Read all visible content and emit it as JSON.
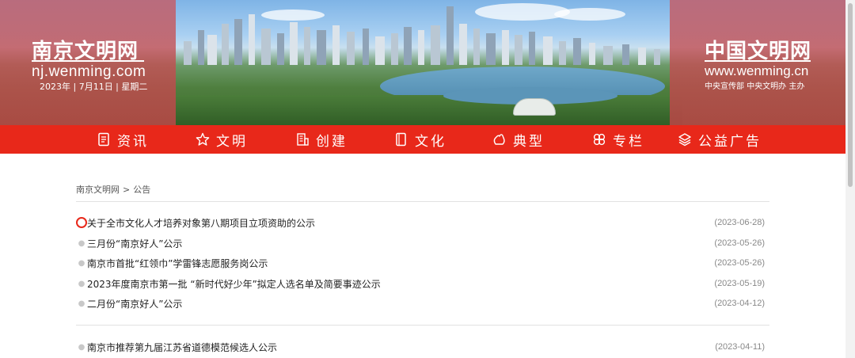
{
  "banner": {
    "left_title": "南京文明网",
    "left_url": "nj.wenming.com",
    "left_date": "2023年 | 7月11日 | 星期二",
    "right_title": "中国文明网",
    "right_url": "www.wenming.cn",
    "right_sub": "中央宣传部  中央文明办 主办"
  },
  "nav": {
    "items": [
      {
        "label": "资讯",
        "icon": "document-icon"
      },
      {
        "label": "文明",
        "icon": "star-icon"
      },
      {
        "label": "创建",
        "icon": "building-icon"
      },
      {
        "label": "文化",
        "icon": "book-icon"
      },
      {
        "label": "典型",
        "icon": "hand-icon"
      },
      {
        "label": "专栏",
        "icon": "flower-icon"
      },
      {
        "label": "公益广告",
        "icon": "layers-icon"
      }
    ]
  },
  "breadcrumb": {
    "home": "南京文明网",
    "separator": ">",
    "current": "公告"
  },
  "list": {
    "group1": [
      {
        "title": "关于全市文化人才培养对象第八期项目立项资助的公示",
        "date": "(2023-06-28)"
      },
      {
        "title": "三月份“南京好人”公示",
        "date": "(2023-05-26)"
      },
      {
        "title": "南京市首批“红领巾”学雷锋志愿服务岗公示",
        "date": "(2023-05-26)"
      },
      {
        "title": "2023年度南京市第一批 “新时代好少年”拟定人选名单及简要事迹公示",
        "date": "(2023-05-19)"
      },
      {
        "title": "二月份“南京好人”公示",
        "date": "(2023-04-12)"
      }
    ],
    "group2": [
      {
        "title": "南京市推荐第九届江苏省道德模范候选人公示",
        "date": "(2023-04-11)"
      }
    ]
  },
  "colors": {
    "nav_bg": "#e8281a",
    "accent": "#e8281a",
    "panel": "#c95860"
  }
}
